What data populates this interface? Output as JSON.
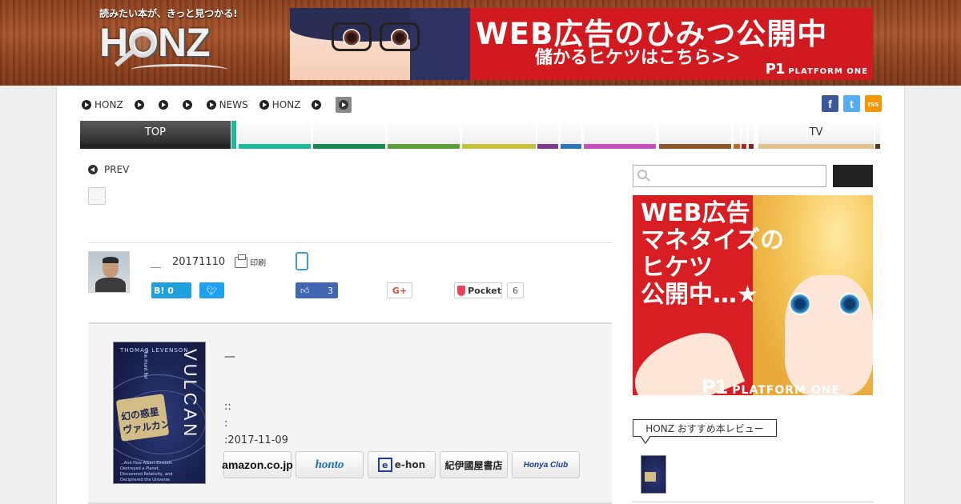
{
  "header": {
    "logo_tagline": "読みたい本が、きっと見つかる!",
    "logo_word": "HONZ",
    "banner_ad": {
      "line1": "WEB広告のひみつ公開中",
      "line2": "儲かるヒケツはこちら>>",
      "brand_mark": "P1",
      "brand_name": "PLATFORM ONE"
    }
  },
  "breadcrumb": {
    "items": [
      {
        "label": "HONZ"
      },
      {
        "label": ""
      },
      {
        "label": ""
      },
      {
        "label": ""
      },
      {
        "label": "NEWS"
      },
      {
        "label": "HONZ"
      },
      {
        "label": ""
      }
    ]
  },
  "social_header": {
    "facebook": "f",
    "twitter": "t",
    "rss": "rss"
  },
  "nav": {
    "items": [
      {
        "label": "TOP",
        "color": "#222222"
      },
      {
        "label": "",
        "color": "#21b79a"
      },
      {
        "label": "",
        "color": "#1b8a55"
      },
      {
        "label": "",
        "color": "#5d9e3c"
      },
      {
        "label": "",
        "color": "#c6c23e"
      },
      {
        "label": "",
        "color": "#7c3c8e"
      },
      {
        "label": "",
        "color": "#3174b8"
      },
      {
        "label": "",
        "color": "#c454ba"
      },
      {
        "label": "",
        "color": "#8a5a2e"
      },
      {
        "label": "",
        "color": "#c06a2a"
      },
      {
        "label": "",
        "color": "#b62727"
      },
      {
        "label": "",
        "color": "#7a2828"
      },
      {
        "label": "TV",
        "color": "#e0c390"
      },
      {
        "label": "",
        "color": "#5a3a18"
      }
    ]
  },
  "article": {
    "prev_label": "PREV",
    "author_name": "＿",
    "date": "20171110",
    "print_label": "印刷"
  },
  "share": {
    "hatena_label": "B! 0",
    "like_count": "3",
    "gplus_label": "G+",
    "pocket_label": "Pocket",
    "pocket_count": "6"
  },
  "book": {
    "cover": {
      "author": "THOMAS LEVENSON",
      "subtitle": "The Hunt for",
      "title": "VULCAN",
      "jp_title": "ヴァルカン",
      "badge_text": "幻の惑星",
      "blurb": "...And How Albert Einstein Destroyed a Planet, Discovered Relativity, and Deciphered the Universe"
    },
    "dash": "—",
    "meta_line1": "::",
    "meta_line2": ":",
    "meta_line3": ":2017-11-09",
    "stores": [
      {
        "label": "amazon.co.jp"
      },
      {
        "label": "honto"
      },
      {
        "label": "e-hon"
      },
      {
        "label": "紀伊國屋書店"
      },
      {
        "label": "Honya Club"
      }
    ]
  },
  "sidebar": {
    "search_placeholder": "",
    "search_button": "",
    "ad": {
      "line1": "WEB広告",
      "line2": "マネタイズの",
      "line3": "ヒケツ",
      "line4": "公開中…★",
      "brand_mark": "P1",
      "brand_name": "PLATFORM ONE"
    },
    "recommend_title": "HONZ おすすめ本レビュー"
  }
}
